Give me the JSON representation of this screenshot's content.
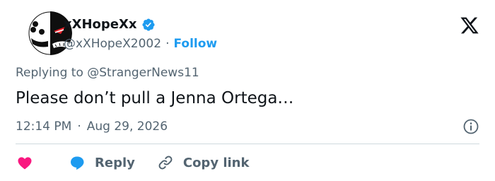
{
  "author": {
    "display_name": "xXHopeXx",
    "handle": "@xXHopeX2002",
    "separator": "·",
    "follow_label": "Follow",
    "verified_color": "#1d9bf0"
  },
  "reply_context": {
    "prefix": "Replying to",
    "mention": "@StrangerNews11"
  },
  "tweet": {
    "text": "Please don’t pull a Jenna Ortega…",
    "time": "12:14 PM",
    "separator": "·",
    "date": "Aug 29, 2026"
  },
  "actions": {
    "reply_label": "Reply",
    "copy_label": "Copy link"
  },
  "icons": {
    "logo": "x-logo-icon",
    "verified": "verified-badge-icon",
    "info": "info-icon",
    "like": "heart-icon",
    "reply": "reply-bubble-icon",
    "copy": "link-icon"
  },
  "colors": {
    "text": "#0f1419",
    "muted": "#536471",
    "accent": "#1d9bf0",
    "like": "#f91880",
    "divider": "#cfd9de"
  }
}
